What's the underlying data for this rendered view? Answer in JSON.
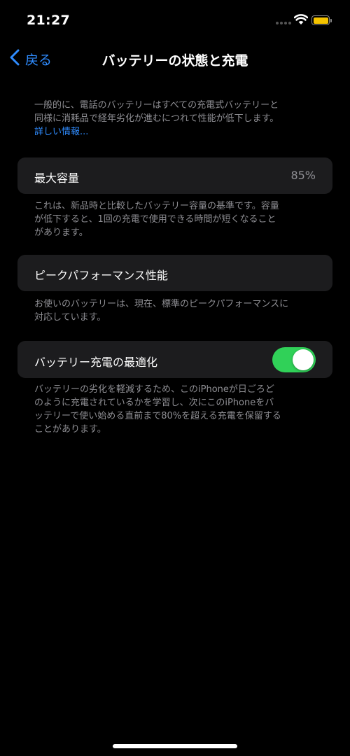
{
  "status_bar": {
    "time": "21:27"
  },
  "nav": {
    "back_label": "戻る",
    "title": "バッテリーの状態と充電"
  },
  "intro": {
    "line1": "一般的に、電話のバッテリーはすべての充電式バッテリーと",
    "line2": "同様に消耗品で経年劣化が進むにつれて性能が低下します。",
    "link": "詳しい情報..."
  },
  "max_capacity": {
    "label": "最大容量",
    "value": "85%",
    "note_line1": "これは、新品時と比較したバッテリー容量の基準です。容量",
    "note_line2": "が低下すると、1回の充電で使用できる時間が短くなること",
    "note_line3": "があります。"
  },
  "peak_performance": {
    "label": "ピークパフォーマンス性能",
    "note_line1": "お使いのバッテリーは、現在、標準のピークパフォーマンスに",
    "note_line2": "対応しています。"
  },
  "optimized_charging": {
    "label": "バッテリー充電の最適化",
    "enabled": true,
    "note_line1": "バッテリーの劣化を軽減するため、このiPhoneが日ごろど",
    "note_line2": "のように充電されているかを学習し、次にこのiPhoneをバ",
    "note_line3": "ッテリーで使い始める直前まで80%を超える充電を保留する",
    "note_line4": "ことがあります。"
  },
  "colors": {
    "accent": "#2f8cff",
    "toggle_on": "#30d158",
    "cell_bg": "#1c1c1e",
    "secondary_text": "#8e8e93",
    "battery_fill": "#f5c400"
  },
  "icons": [
    "back-chevron-icon",
    "signal-icon",
    "wifi-icon",
    "battery-icon"
  ]
}
